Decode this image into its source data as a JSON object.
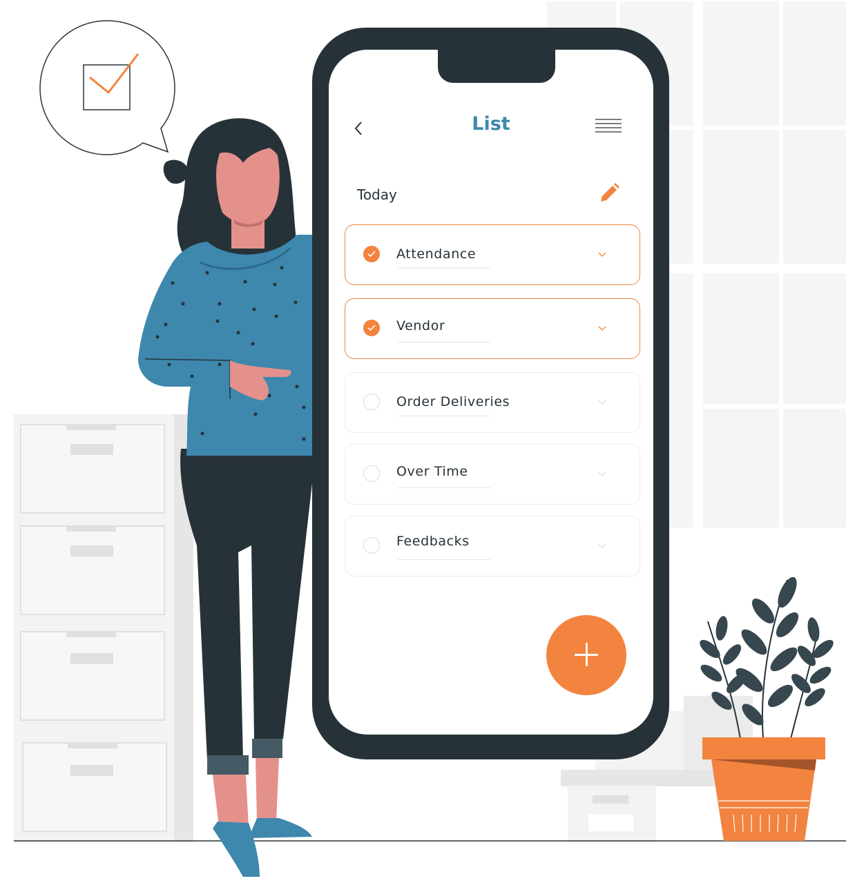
{
  "header": {
    "title": "List"
  },
  "section": {
    "label": "Today"
  },
  "tasks": [
    {
      "label": "Attendance",
      "checked": true
    },
    {
      "label": "Vendor",
      "checked": true
    },
    {
      "label": "Order Deliveries",
      "checked": false
    },
    {
      "label": "Over Time",
      "checked": false
    },
    {
      "label": "Feedbacks",
      "checked": false
    }
  ],
  "icons": {
    "back": "chevron-left-icon",
    "menu": "hamburger-icon",
    "edit": "pencil-icon",
    "check": "checkmark-icon",
    "expand": "chevron-down-icon",
    "add": "plus-icon"
  },
  "colors": {
    "accent": "#f2843f",
    "title": "#3e87ad",
    "phone": "#263238",
    "shirt": "#3e87ad",
    "pants": "#263238",
    "skin": "#e4918c",
    "plant_leaves": "#37474f"
  }
}
